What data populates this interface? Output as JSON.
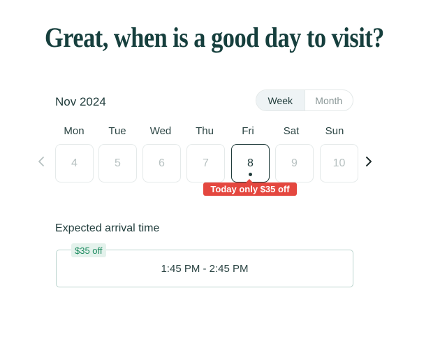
{
  "header": {
    "title": "Great, when is a good day to visit?"
  },
  "calendar": {
    "month_label": "Nov 2024",
    "view_toggle": {
      "options": [
        "Week",
        "Month"
      ],
      "selected": "Week"
    },
    "weekdays": [
      "Mon",
      "Tue",
      "Wed",
      "Thu",
      "Fri",
      "Sat",
      "Sun"
    ],
    "days": [
      "4",
      "5",
      "6",
      "7",
      "8",
      "9",
      "10"
    ],
    "selected_day": "8",
    "prev_icon": "chevron-left-icon",
    "next_icon": "chevron-right-icon",
    "promo_tooltip": "Today only $35 off"
  },
  "arrival": {
    "label": "Expected arrival time",
    "slots": [
      {
        "time": "1:45 PM - 2:45 PM",
        "badge": "$35 off"
      }
    ]
  },
  "colors": {
    "primary_text": "#1f3b3a",
    "promo_red": "#e4473f",
    "badge_green_text": "#1c8a5f",
    "badge_green_bg": "#e4f2ec",
    "slot_border": "#bcd5cf"
  }
}
